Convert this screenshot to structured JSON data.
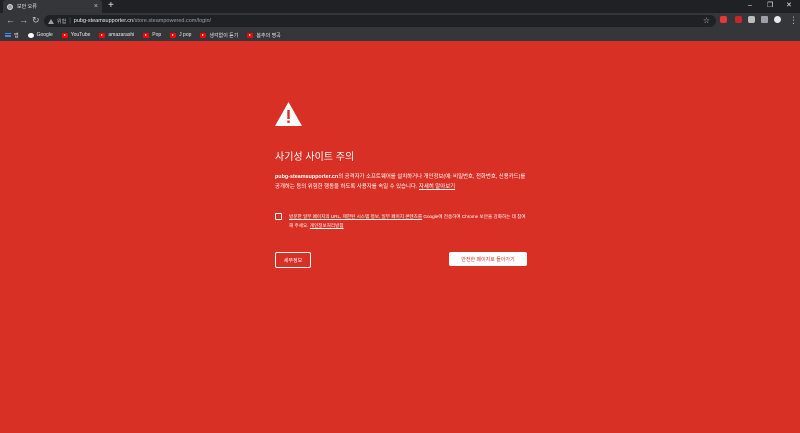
{
  "tab": {
    "title": "보안 오류",
    "close_icon": "×"
  },
  "window": {
    "new_tab": "+",
    "minimize": "–",
    "restore": "❐",
    "close": "✕"
  },
  "toolbar": {
    "back": "←",
    "forward": "→",
    "reload": "↻",
    "security_label": "위험",
    "url_host": "pubg-steamsupporter.cn",
    "url_path": "/store.steampowered.com/login/",
    "bookmark_star": "☆",
    "menu": "⋮"
  },
  "bookmarks": [
    {
      "label": "앱",
      "icon": "apps-icon"
    },
    {
      "label": "Google",
      "icon": "google-icon"
    },
    {
      "label": "YouTube",
      "icon": "youtube-icon"
    },
    {
      "label": "amazarashi",
      "icon": "youtube-icon"
    },
    {
      "label": "Pop",
      "icon": "youtube-icon"
    },
    {
      "label": "J pop",
      "icon": "youtube-icon"
    },
    {
      "label": "생각없이 듣기",
      "icon": "youtube-icon"
    },
    {
      "label": "봄추의 명곡",
      "icon": "youtube-icon"
    }
  ],
  "interstitial": {
    "heading": "사기성 사이트 주의",
    "site": "pubg-steamsupporter.cn",
    "description": "의 공격자가 소프트웨어를 설치하거나 개인정보(예: 비밀번호, 전화번호, 신용카드)를 공개하는 등의 위험한 행동을 하도록 사용자를 속일 수 있습니다. ",
    "learn_more": "자세히 알아보기",
    "optin_link": "방문한 일부 페이지의 URL, 제한된 시스템 정보, 일부 페이지 콘텐츠를",
    "optin_text": " Google에 전송하여 Chrome 보안을 강화하는 데 참여해 주세요. ",
    "privacy_link": "개인정보처리방침",
    "details_button": "세부정보",
    "back_button": "안전한 페이지로 돌아가기"
  },
  "colors": {
    "background": "#d93025",
    "chrome_dark": "#202124",
    "chrome": "#35363a"
  }
}
